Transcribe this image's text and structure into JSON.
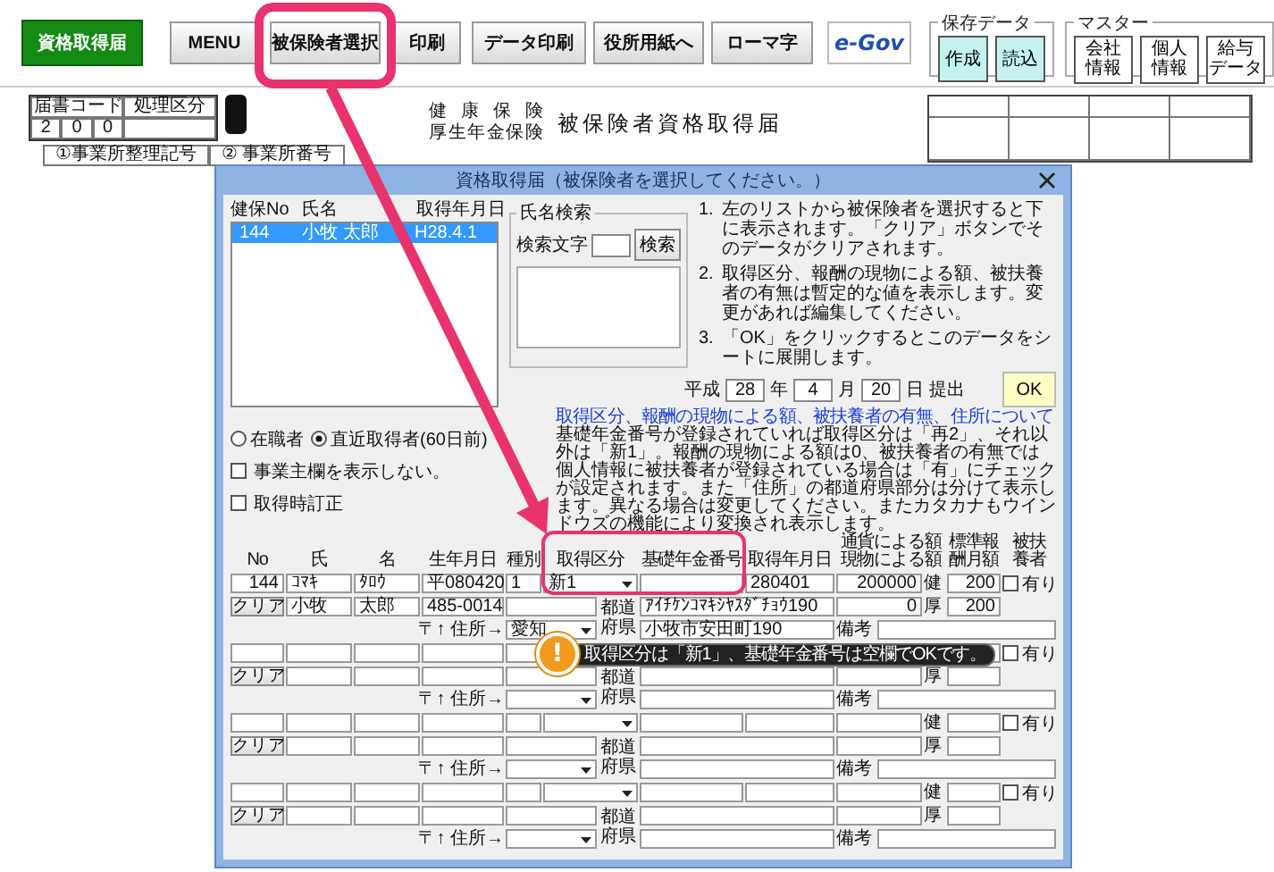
{
  "toolbar": {
    "main_button": "資格取得届",
    "buttons": [
      "MENU",
      "被保険者選択",
      "印刷",
      "データ印刷",
      "役所用紙へ",
      "ローマ字"
    ],
    "logo": "e-Gov",
    "save_group": {
      "title": "保存データ",
      "buttons": [
        "作成",
        "読込"
      ]
    },
    "master_group": {
      "title": "マスター",
      "buttons": [
        [
          "会社",
          "情報"
        ],
        [
          "個人",
          "情報"
        ],
        [
          "給与",
          "データ"
        ]
      ]
    }
  },
  "sheet": {
    "code_headers": [
      "届書コード",
      "処理区分"
    ],
    "code_digits": [
      "2",
      "0",
      "0"
    ],
    "title_lines": [
      "健康保険",
      "厚生年金保険"
    ],
    "title": "被保険者資格取得届",
    "field_labels": [
      "①事業所整理記号",
      "② 事業所番号"
    ]
  },
  "dialog": {
    "title": "資格取得届（被保険者を選択してください。）",
    "list": {
      "columns": [
        "健保No",
        "氏名",
        "取得年月日"
      ],
      "rows": [
        {
          "no": "144",
          "name": "小牧 太郎",
          "date": "H28.4.1",
          "selected": true
        }
      ]
    },
    "search": {
      "title": "氏名検索",
      "label": "検索文字",
      "button": "検索"
    },
    "instructions": [
      {
        "number": "1.",
        "text": "左のリストから被保険者を選択すると下に表示されます。「クリア」ボタンでそのデータがクリアされます。"
      },
      {
        "number": "2.",
        "text": "取得区分、報酬の現物による額、被扶養者の有無は暫定的な値を表示します。変更があれば編集してください。"
      },
      {
        "number": "3.",
        "text": "「OK」をクリックするとこのデータをシートに展開します。"
      }
    ],
    "date": {
      "era": "平成",
      "year": "28",
      "year_unit": "年",
      "month": "4",
      "month_unit": "月",
      "day": "20",
      "day_unit": "日",
      "suffix": "提出"
    },
    "ok_button": "OK",
    "link": "取得区分、報酬の現物による額、被扶養者の有無、住所について",
    "note": "基礎年金番号が登録されていれば取得区分は「再2」、それ以外は「新1」。報酬の現物による額は0、被扶養者の有無では個人情報に被扶養者が登録されている場合は「有」にチェックが設定されます。また「住所」の都道府県部分は分けて表示します。異なる場合は変更してください。またカタカナもウインドウズの機能により変換され表示します。",
    "radios": [
      {
        "label": "在職者",
        "selected": false
      },
      {
        "label": "直近取得者(60日前)",
        "selected": true
      }
    ],
    "hide_owner": {
      "label": "事業主欄を表示しない。",
      "checked": false
    },
    "correction": {
      "label": "取得時訂正",
      "checked": false
    },
    "columns": [
      "No",
      "氏",
      "名",
      "生年月日",
      "種別",
      "取得区分",
      "基礎年金番号",
      "取得年月日",
      "通貨による額現物による額",
      "標準報酬月額",
      "被扶養者"
    ],
    "entries": [
      {
        "no": "144",
        "kana_surname": "ｺﾏｷ",
        "kana_given": "ﾀﾛｳ",
        "birth": "平080420",
        "type": "1",
        "acquisition_class": "新1",
        "acquisition_date": "280401",
        "cash_amount": "200000",
        "health_label": "健",
        "health_std": "200",
        "dependent_label": "有り",
        "dependent": false,
        "clear_button": "クリア",
        "kanji_surname": "小牧",
        "kanji_given": "太郎",
        "postal": "485-0014",
        "kana_address": "ｱｲﾁｹﾝｺﾏｷｼﾔｽﾀﾞﾁｮｳ190",
        "kind_amount": "0",
        "pension_label": "厚",
        "pension_std": "200",
        "address_label": "〒↑ 住所→",
        "prefecture": "愛知",
        "prefecture_label": "都道府県",
        "address": "小牧市安田町190",
        "remarks_label": "備考"
      },
      {
        "dependent_label": "有り",
        "dependent": false,
        "clear_button": "クリア",
        "pension_label": "厚",
        "address_label": "〒↑ 住所→",
        "prefecture_label": "都道府県",
        "remarks_label": "備考"
      },
      {
        "health_label": "健",
        "dependent_label": "有り",
        "dependent": false,
        "clear_button": "クリア",
        "pension_label": "厚",
        "address_label": "〒↑ 住所→",
        "prefecture_label": "都道府県",
        "remarks_label": "備考"
      },
      {
        "health_label": "健",
        "dependent_label": "有り",
        "dependent": false,
        "clear_button": "クリア",
        "pension_label": "厚",
        "address_label": "〒↑ 住所→",
        "prefecture_label": "都道府県",
        "remarks_label": "備考"
      }
    ]
  },
  "callout": {
    "mark": "!",
    "text": "取得区分は「新1」、基礎年金番号は空欄でOKです。"
  }
}
